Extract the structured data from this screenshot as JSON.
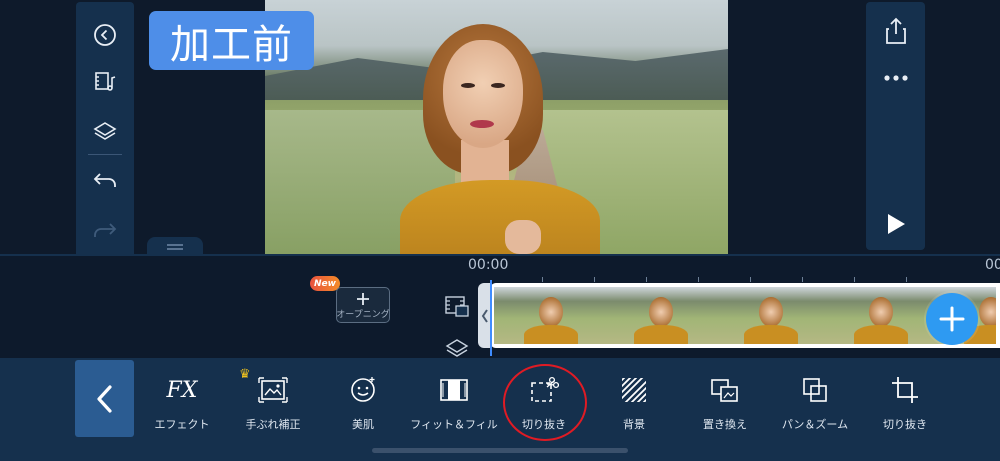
{
  "preview": {
    "before_badge": "加工前"
  },
  "left_sidebar": {
    "items": [
      {
        "name": "back-circle-icon"
      },
      {
        "name": "music-film-icon"
      },
      {
        "name": "layers-icon"
      },
      {
        "name": "undo-icon"
      },
      {
        "name": "redo-icon"
      },
      {
        "name": "trash-icon"
      }
    ]
  },
  "right_sidebar": {
    "items": [
      {
        "name": "share-icon"
      },
      {
        "name": "more-icon"
      },
      {
        "name": "play-icon"
      }
    ]
  },
  "timeline": {
    "time_start": "00:00",
    "time_next": "00",
    "opening_label": "オープニング",
    "new_badge": "New"
  },
  "toolbar": {
    "tools": [
      {
        "label": "エフェクト",
        "icon": "fx-icon"
      },
      {
        "label": "手ぶれ補正",
        "icon": "stabilize-icon"
      },
      {
        "label": "美肌",
        "icon": "beauty-face-icon"
      },
      {
        "label": "フィット＆フィル",
        "icon": "fit-fill-icon"
      },
      {
        "label": "切り抜き",
        "icon": "cutout-icon"
      },
      {
        "label": "背景",
        "icon": "background-icon"
      },
      {
        "label": "置き換え",
        "icon": "replace-icon"
      },
      {
        "label": "パン＆ズーム",
        "icon": "pan-zoom-icon"
      },
      {
        "label": "切り抜き",
        "icon": "crop-icon"
      }
    ]
  },
  "colors": {
    "panel": "#15304d",
    "background": "#0e1a2b",
    "accent_blue": "#2e9af2",
    "highlight_red": "#e01b24",
    "badge_blue": "#4e8ee8"
  }
}
